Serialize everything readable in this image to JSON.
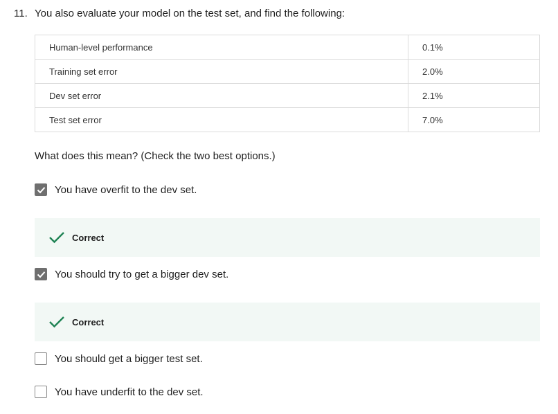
{
  "question": {
    "number": "11.",
    "text": "You also evaluate your model on the test set, and find the following:"
  },
  "table": {
    "rows": [
      {
        "label": "Human-level performance",
        "value": "0.1%"
      },
      {
        "label": "Training set error",
        "value": "2.0%"
      },
      {
        "label": "Dev set error",
        "value": "2.1%"
      },
      {
        "label": "Test set error",
        "value": "7.0%"
      }
    ]
  },
  "prompt": "What does this mean? (Check the two best options.)",
  "options": [
    {
      "label": "You have overfit to the dev set.",
      "checked": true,
      "feedback": "Correct"
    },
    {
      "label": "You should try to get a bigger dev set.",
      "checked": true,
      "feedback": "Correct"
    },
    {
      "label": "You should get a bigger test set.",
      "checked": false
    },
    {
      "label": "You have underfit to the dev set.",
      "checked": false
    }
  ],
  "colors": {
    "correct_check": "#1f8354",
    "feedback_bg": "#f2f8f5",
    "checkbox_checked": "#6f6f6f",
    "checkbox_border": "#8a8a8a"
  },
  "icons": {
    "checkbox_checked": "checkmark-icon",
    "feedback": "correct-check-icon"
  }
}
